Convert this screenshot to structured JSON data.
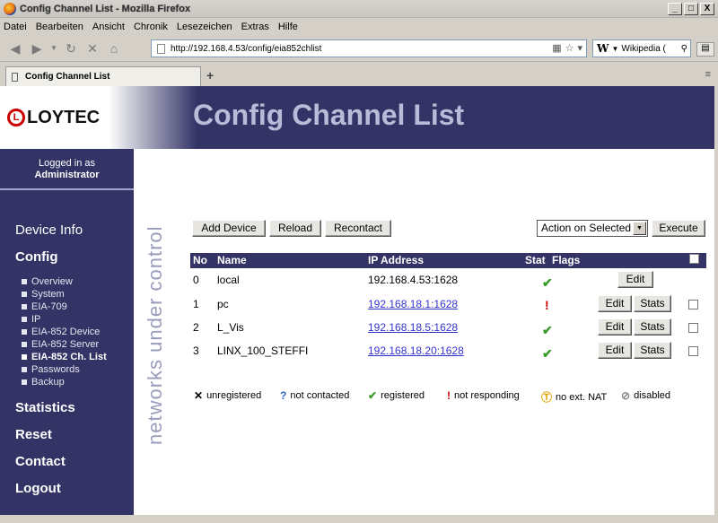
{
  "window": {
    "title": "Config Channel List - Mozilla Firefox",
    "minimize": "_",
    "maximize": "□",
    "close": "X"
  },
  "menu": [
    "Datei",
    "Bearbeiten",
    "Ansicht",
    "Chronik",
    "Lesezeichen",
    "Extras",
    "Hilfe"
  ],
  "navbar": {
    "url": "http://192.168.4.53/config/eia852chlist",
    "search_text": "Wikipedia (",
    "search_engine_icon": "W"
  },
  "tabs": [
    {
      "label": "Config Channel List"
    }
  ],
  "header": {
    "logo_text": "LOYTEC",
    "logo_letter": "L",
    "title": "Config Channel List"
  },
  "sidebar": {
    "logged_in_label": "Logged in as",
    "user": "Administrator",
    "items": {
      "device_info": "Device Info",
      "config": "Config",
      "statistics": "Statistics",
      "reset": "Reset",
      "contact": "Contact",
      "logout": "Logout"
    },
    "config_sub": [
      "Overview",
      "System",
      "EIA-709",
      "IP",
      "EIA-852 Device",
      "EIA-852 Server",
      "EIA-852 Ch. List",
      "Passwords",
      "Backup"
    ]
  },
  "tagline": "networks under control",
  "toolbar": {
    "add_device": "Add Device",
    "reload": "Reload",
    "recontact": "Recontact",
    "action_select": "Action on Selected",
    "execute": "Execute"
  },
  "table": {
    "headers": {
      "no": "No",
      "name": "Name",
      "ip": "IP Address",
      "stat": "Stat",
      "flags": "Flags"
    },
    "rows": [
      {
        "no": "0",
        "name": "local",
        "ip": "192.168.4.53:1628",
        "status": "registered",
        "edit": "Edit"
      },
      {
        "no": "1",
        "name": "pc",
        "ip": "192.168.18.1:1628",
        "status": "not responding",
        "edit": "Edit",
        "stats": "Stats"
      },
      {
        "no": "2",
        "name": "L_Vis",
        "ip": "192.168.18.5:1628",
        "status": "registered",
        "edit": "Edit",
        "stats": "Stats"
      },
      {
        "no": "3",
        "name": "LINX_100_STEFFI",
        "ip": "192.168.18.20:1628",
        "status": "registered",
        "edit": "Edit",
        "stats": "Stats"
      }
    ]
  },
  "legend": {
    "unregistered": "unregistered",
    "not_contacted": "not contacted",
    "registered": "registered",
    "not_responding": "not responding",
    "no_ext_nat": "no ext. NAT",
    "disabled": "disabled"
  },
  "colors": {
    "brand": "#333366",
    "ok": "#3a9a2a",
    "error": "#cc0000",
    "link": "#3333cc"
  }
}
